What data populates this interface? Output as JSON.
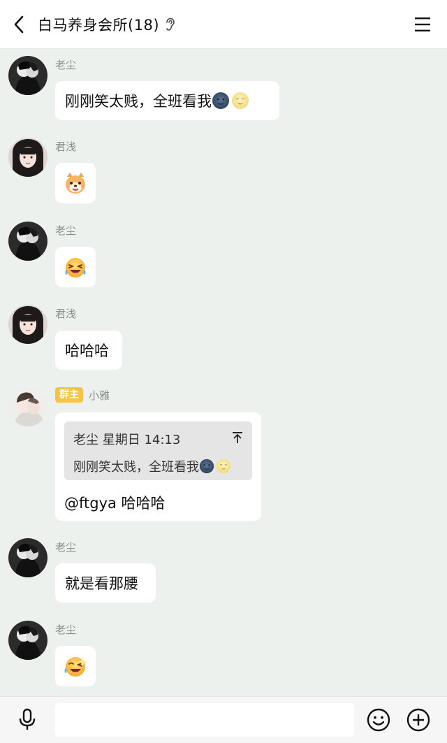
{
  "header": {
    "title": "白马养身会所(18)",
    "back_icon": "chevron-left-icon",
    "ear_icon": "ear-icon",
    "menu_icon": "hamburger-menu-icon"
  },
  "messages": [
    {
      "sender": "老尘",
      "avatar": "avatar-laochen",
      "text": "刚刚笑太贱，全班看我",
      "emojis": [
        "new-moon-face",
        "full-moon-face"
      ]
    },
    {
      "sender": "君浅",
      "avatar": "avatar-junqian",
      "sticker": "cartoon-dog-sticker"
    },
    {
      "sender": "老尘",
      "avatar": "avatar-laochen",
      "sticker": "laughing-tears-sticker"
    },
    {
      "sender": "君浅",
      "avatar": "avatar-junqian",
      "text": "哈哈哈"
    },
    {
      "sender": "小雅",
      "badge": "群主",
      "avatar": "avatar-xiaoya",
      "quote": {
        "author": "老尘",
        "time": "星期日 14:13",
        "text": "刚刚笑太贱，全班看我",
        "emojis": [
          "new-moon-face",
          "full-moon-face"
        ]
      },
      "text": "@ftgya 哈哈哈"
    },
    {
      "sender": "老尘",
      "avatar": "avatar-laochen",
      "text": "就是看那腰"
    },
    {
      "sender": "老尘",
      "avatar": "avatar-laochen",
      "sticker": "laughing-wink-sticker"
    }
  ],
  "input": {
    "placeholder": "",
    "value": ""
  },
  "toolbar": {
    "mic_icon": "microphone-icon",
    "emoji_icon": "smiley-icon",
    "plus_icon": "plus-circle-icon"
  }
}
